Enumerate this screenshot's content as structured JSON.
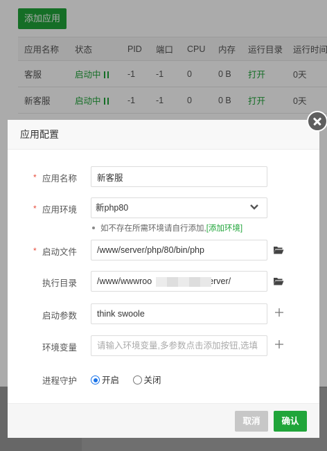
{
  "toolbar": {
    "add_app_label": "添加应用"
  },
  "table": {
    "headers": [
      "应用名称",
      "状态",
      "PID",
      "端口",
      "CPU",
      "内存",
      "运行目录",
      "运行时间"
    ],
    "rows": [
      [
        "客服",
        "启动中",
        "-1",
        "-1",
        "0",
        "0 B",
        "打开",
        "0天"
      ],
      [
        "新客服",
        "启动中",
        "-1",
        "-1",
        "0",
        "0 B",
        "打开",
        "0天"
      ]
    ]
  },
  "modal": {
    "title": "应用配置",
    "fields": {
      "app_name": {
        "label": "应用名称",
        "value": "新客服"
      },
      "app_env": {
        "label": "应用环境",
        "value": "新php80"
      },
      "env_hint": {
        "text": "如不存在所需环境请自行添加,",
        "link": "[添加环境]"
      },
      "start_file": {
        "label": "启动文件",
        "value": "/www/server/php/80/bin/php"
      },
      "exec_dir": {
        "label": "执行目录",
        "value_prefix": "/www/wwwroo",
        "value_suffix": "erver/"
      },
      "start_args": {
        "label": "启动参数",
        "value": "think swoole"
      },
      "env_vars": {
        "label": "环境变量",
        "placeholder": "请输入环境变量,多参数点击添加按钮,选填"
      },
      "daemon": {
        "label": "进程守护",
        "on_label": "开启",
        "off_label": "关闭",
        "selected": "on"
      }
    },
    "buttons": {
      "cancel": "取消",
      "confirm": "确认"
    }
  },
  "colors": {
    "brand_green": "#20a53a",
    "radio_blue": "#1a73e8",
    "required_red": "#e74c3c"
  }
}
